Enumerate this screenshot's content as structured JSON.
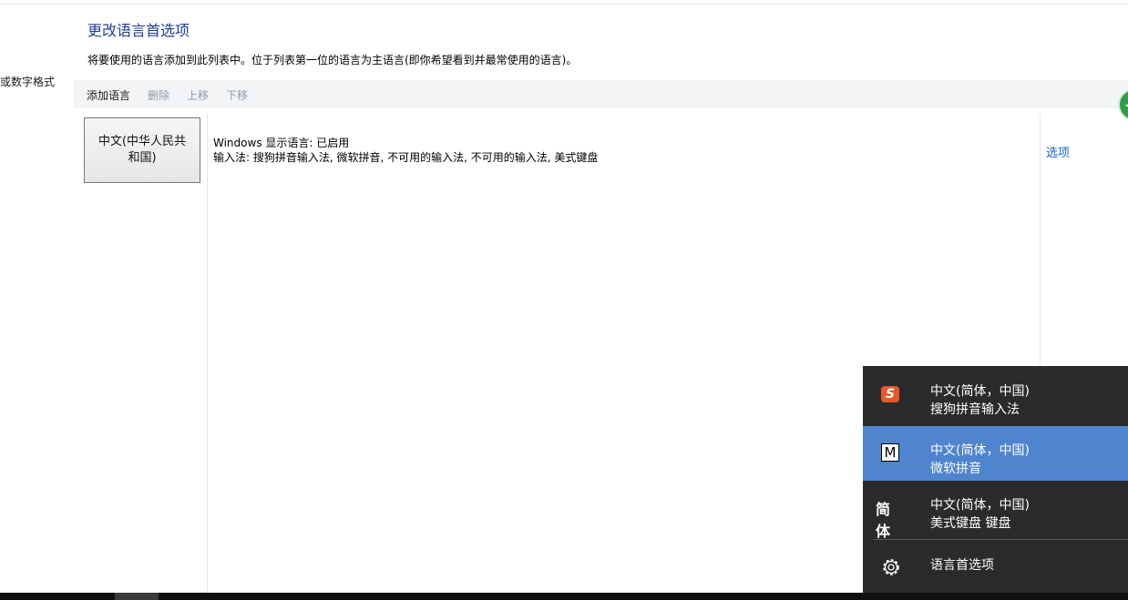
{
  "sidebar": {
    "partial_link": "或数字格式"
  },
  "header": {
    "title": "更改语言首选项",
    "description": "将要使用的语言添加到此列表中。位于列表第一位的语言为主语言(即你希望看到并最常使用的语言)。"
  },
  "toolbar": {
    "add_label": "添加语言",
    "remove_label": "删除",
    "move_up_label": "上移",
    "move_down_label": "下移"
  },
  "languages": [
    {
      "name_line1": "中文(中华人民共",
      "name_line2": "和国)",
      "status_line1": "Windows 显示语言: 已启用",
      "status_line2": "输入法: 搜狗拼音输入法, 微软拼音, 不可用的输入法, 不可用的输入法, 美式键盘",
      "options_label": "选项"
    }
  ],
  "ime_menu": {
    "items": [
      {
        "icon": "sogou-icon",
        "language": "中文(简体，中国)",
        "method": "搜狗拼音输入法",
        "selected": false
      },
      {
        "icon": "m-icon",
        "icon_text": "M",
        "language": "中文(简体，中国)",
        "method": "微软拼音",
        "selected": true
      },
      {
        "icon": "jianti-icon",
        "icon_text": "简体",
        "language": "中文(简体，中国)",
        "method": "美式键盘 键盘",
        "selected": false
      }
    ],
    "preferences_label": "语言首选项"
  },
  "colors": {
    "title": "#1e3c96",
    "link": "#1a64c8",
    "menu_bg": "#2b2b2b",
    "menu_selected": "#4f84cf",
    "sogou": "#e8572a"
  }
}
